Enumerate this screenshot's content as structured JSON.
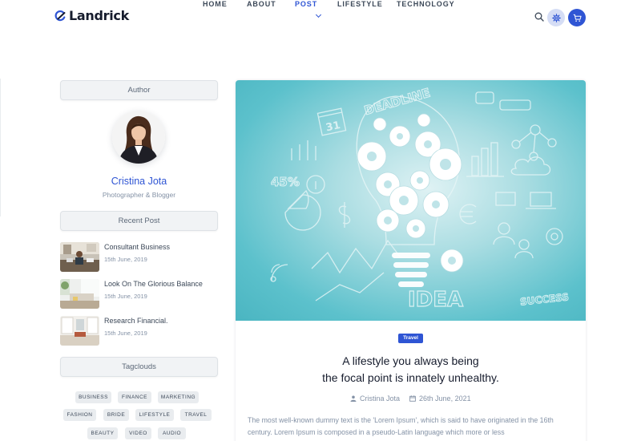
{
  "brand": {
    "name": "Landrick"
  },
  "nav": {
    "items": [
      {
        "label": "HOME"
      },
      {
        "label": "ABOUT"
      },
      {
        "label": "POST"
      },
      {
        "label": "LIFESTYLE"
      },
      {
        "label": "TECHNOLOGY"
      }
    ],
    "active": "POST"
  },
  "header_icons": [
    "search-icon",
    "settings-icon",
    "cart-icon"
  ],
  "sidebar": {
    "author": {
      "title": "Author",
      "name": "Cristina Jota",
      "role": "Photographer & Blogger"
    },
    "recent": {
      "title": "Recent Post",
      "posts": [
        {
          "title": "Consultant Business",
          "date": "15th June, 2019"
        },
        {
          "title": "Look On The Glorious Balance",
          "date": "15th June, 2019"
        },
        {
          "title": "Research Financial.",
          "date": "15th June, 2019"
        }
      ]
    },
    "tags": {
      "title": "Tagclouds",
      "items": [
        "BUSINESS",
        "FINANCE",
        "MARKETING",
        "FASHION",
        "BRIDE",
        "LIFESTYLE",
        "TRAVEL",
        "BEAUTY",
        "VIDEO",
        "AUDIO"
      ]
    }
  },
  "article": {
    "badge": "Travel",
    "title_line1": "A lifestyle you always being",
    "title_line2": "the focal point is innately unhealthy.",
    "author": "Cristina Jota",
    "date": "26th June, 2021",
    "excerpt": "The most well-known dummy text is the 'Lorem Ipsum', which is said to have originated in the 16th century. Lorem Ipsum is composed in a pseudo-Latin language which more or less",
    "image_words": [
      "DEADLINE",
      "31",
      "45%",
      "IDEA",
      "SUCCESS"
    ]
  },
  "colors": {
    "primary": "#2f55d4",
    "text_dark": "#161c2d",
    "text_muted": "#8492a6",
    "hero_teal": "#4ab5c1"
  }
}
